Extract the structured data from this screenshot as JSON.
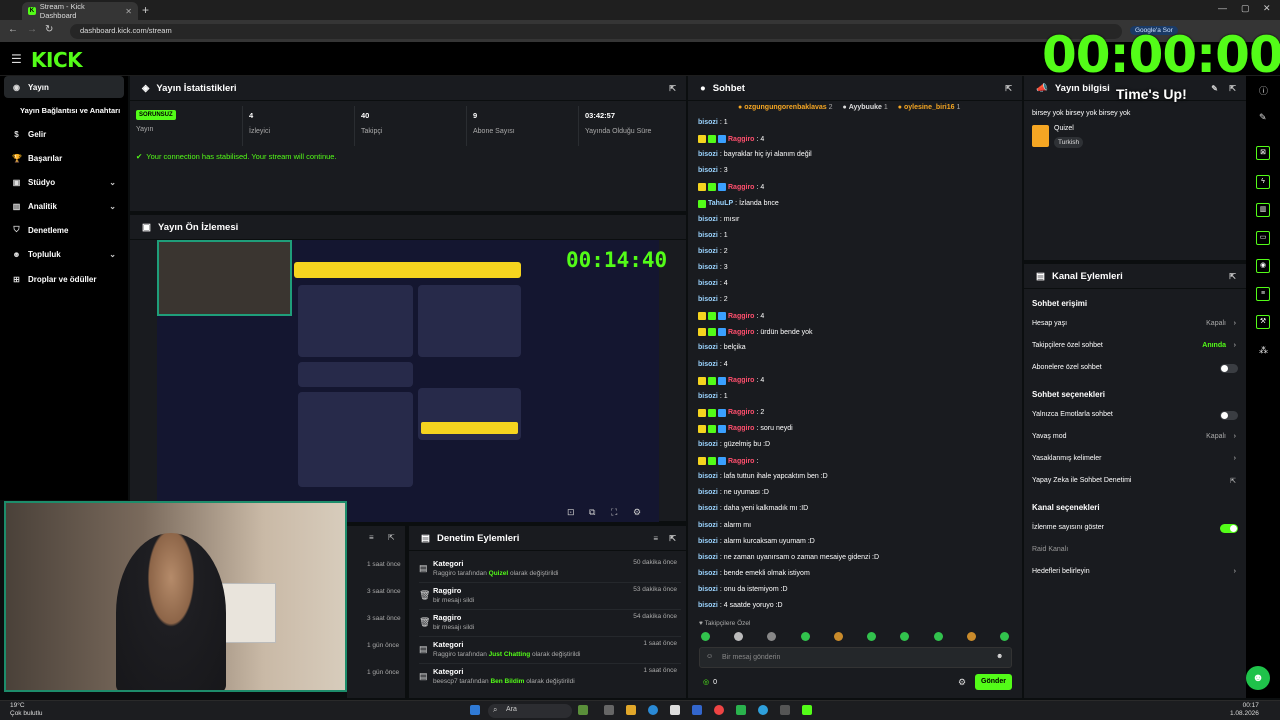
{
  "browser": {
    "tab_title": "Stream - Kick Dashboard",
    "url": "dashboard.kick.com/stream",
    "google_button": "Google'a Sor"
  },
  "app": {
    "logo": "KICK"
  },
  "sidebar": {
    "items": [
      {
        "label": "Yayın",
        "icon": "broadcast-icon"
      },
      {
        "label": "Yayın Bağlantısı ve Anahtarı",
        "icon": ""
      },
      {
        "label": "Gelir",
        "icon": "dollar-icon"
      },
      {
        "label": "Başarılar",
        "icon": "trophy-icon"
      },
      {
        "label": "Stüdyo",
        "icon": "studio-icon"
      },
      {
        "label": "Analitik",
        "icon": "chart-icon"
      },
      {
        "label": "Denetleme",
        "icon": "shield-icon"
      },
      {
        "label": "Topluluk",
        "icon": "community-icon"
      },
      {
        "label": "Droplar ve ödüller",
        "icon": "gift-icon"
      }
    ]
  },
  "stats": {
    "title": "Yayın İstatistikleri",
    "status_badge": "SORUNSUZ",
    "status_label": "Yayın",
    "viewers": "4",
    "viewers_label": "İzleyici",
    "followers": "40",
    "followers_label": "Takipçi",
    "subs": "9",
    "subs_label": "Abone Sayısı",
    "uptime": "03:42:57",
    "uptime_label": "Yayında Olduğu Süre",
    "connection_msg": "Your connection has stabilised. Your stream will continue."
  },
  "preview": {
    "title": "Yayın Ön İzlemesi",
    "overlay_timer": "00:14:40"
  },
  "moderation": {
    "title": "Denetim Eylemleri",
    "left_times": [
      "1 saat önce",
      "3 saat önce",
      "3 saat önce",
      "1 gün önce",
      "1 gün önce"
    ],
    "items": [
      {
        "title": "Kategori",
        "line_pre": "Raggiro tarafından ",
        "line_hl": "Quizel",
        "line_post": " olarak değiştirildi",
        "time": "50 dakika önce",
        "icon": "category-icon"
      },
      {
        "title": "Raggiro",
        "line_pre": "bir mesajı sildi",
        "line_hl": "",
        "line_post": "",
        "time": "53 dakika önce",
        "icon": "trash-icon"
      },
      {
        "title": "Raggiro",
        "line_pre": "bir mesajı sildi",
        "line_hl": "",
        "line_post": "",
        "time": "54 dakika önce",
        "icon": "trash-icon"
      },
      {
        "title": "Kategori",
        "line_pre": "Raggiro tarafından ",
        "line_hl": "Just Chatting",
        "line_post": " olarak değiştirildi",
        "time": "1 saat önce",
        "icon": "category-icon"
      },
      {
        "title": "Kategori",
        "line_pre": "beescp7 tarafından ",
        "line_hl": "Ben Bildim",
        "line_post": " olarak değiştirildi",
        "time": "1 saat önce",
        "icon": "category-icon"
      }
    ]
  },
  "chat": {
    "title": "Sohbet",
    "toppers": [
      {
        "name": "ozgungungorenbaklavas",
        "count": "2",
        "color": "#f5a623"
      },
      {
        "name": "Ayybuuke",
        "count": "1",
        "color": "#dddddd"
      },
      {
        "name": "oylesine_biri16",
        "count": "1",
        "color": "#f5a623"
      }
    ],
    "messages": [
      {
        "user": "bisozi",
        "text": "1",
        "type": "b"
      },
      {
        "user": "Raggiro",
        "text": "4",
        "type": "r"
      },
      {
        "user": "bisozi",
        "text": "bayraklar hiç iyi alanım değil",
        "type": "b"
      },
      {
        "user": "bisozi",
        "text": "3",
        "type": "b"
      },
      {
        "user": "Raggiro",
        "text": "4",
        "type": "r"
      },
      {
        "user": "TahuLP",
        "text": "İzlanda bnce",
        "type": "t"
      },
      {
        "user": "bisozi",
        "text": "mısır",
        "type": "b"
      },
      {
        "user": "bisozi",
        "text": "1",
        "type": "b"
      },
      {
        "user": "bisozi",
        "text": "2",
        "type": "b"
      },
      {
        "user": "bisozi",
        "text": "3",
        "type": "b"
      },
      {
        "user": "bisozi",
        "text": "4",
        "type": "b"
      },
      {
        "user": "bisozi",
        "text": "2",
        "type": "b"
      },
      {
        "user": "Raggiro",
        "text": "4",
        "type": "r"
      },
      {
        "user": "Raggiro",
        "text": "ürdün bende yok",
        "type": "r"
      },
      {
        "user": "bisozi",
        "text": "belçika",
        "type": "b"
      },
      {
        "user": "bisozi",
        "text": "4",
        "type": "b"
      },
      {
        "user": "Raggiro",
        "text": "4",
        "type": "r"
      },
      {
        "user": "bisozi",
        "text": "1",
        "type": "b"
      },
      {
        "user": "Raggiro",
        "text": "2",
        "type": "r"
      },
      {
        "user": "Raggiro",
        "text": "soru neydi",
        "type": "r"
      },
      {
        "user": "bisozi",
        "text": "güzelmiş bu :D",
        "type": "b"
      },
      {
        "user": "Raggiro",
        "text": "",
        "type": "r"
      },
      {
        "user": "bisozi",
        "text": "lafa tuttun ihale yapcaktım ben :D",
        "type": "b"
      },
      {
        "user": "bisozi",
        "text": "ne uyuması :D",
        "type": "b"
      },
      {
        "user": "bisozi",
        "text": "daha yeni kalkmadık mı :ID",
        "type": "b"
      },
      {
        "user": "bisozi",
        "text": "alarm mı",
        "type": "b"
      },
      {
        "user": "bisozi",
        "text": "alarm kurcaksam uyumam :D",
        "type": "b"
      },
      {
        "user": "bisozi",
        "text": "ne zaman uyanırsam o zaman mesaiye gidenzi :D",
        "type": "b"
      },
      {
        "user": "bisozi",
        "text": "bende emekli olmak istiyom",
        "type": "b"
      },
      {
        "user": "bisozi",
        "text": "onu da istemiyom :D",
        "type": "b"
      },
      {
        "user": "bisozi",
        "text": "4 saatde yoruyo :D",
        "type": "b"
      }
    ],
    "followers_only": "Takipçilere Özel",
    "input_placeholder": "Bir mesaj gönderin",
    "count": "0",
    "send_label": "Gönder"
  },
  "stream_info": {
    "title": "Yayın bilgisi",
    "stream_title": "birsey yok birsey yok birsey yok",
    "category": "Quizel",
    "language": "Turkish"
  },
  "channel_actions": {
    "title": "Kanal Eylemleri",
    "chat_access": "Sohbet erişimi",
    "account_age": "Hesap yaşı",
    "account_age_val": "Kapalı",
    "followers_only": "Takipçilere özel sohbet",
    "followers_only_val": "Anında",
    "subs_only": "Abonelere özel sohbet",
    "chat_options": "Sohbet seçenekleri",
    "emotes_only": "Yalnızca Emotlarla sohbet",
    "slow_mode": "Yavaş mod",
    "slow_mode_val": "Kapalı",
    "banned_words": "Yasaklanmış kelimeler",
    "ai_moderation": "Yapay Zeka ile Sohbet Denetimi",
    "channel_options": "Kanal seçenekleri",
    "show_viewers": "İzlenme sayısını göster",
    "raid_channel": "Raid Kanalı",
    "set_targets": "Hedefleri belirleyin"
  },
  "overlay": {
    "big_timer": "00:00:00",
    "times_up": "Time's Up!"
  },
  "taskbar": {
    "temp": "19°C",
    "weather": "Çok bulutlu",
    "search": "Ara",
    "time": "00:17",
    "date": "1.08.2026"
  },
  "colors": {
    "accent": "#53fc18",
    "panel": "#191b1f",
    "bg": "#0b0e0f"
  }
}
